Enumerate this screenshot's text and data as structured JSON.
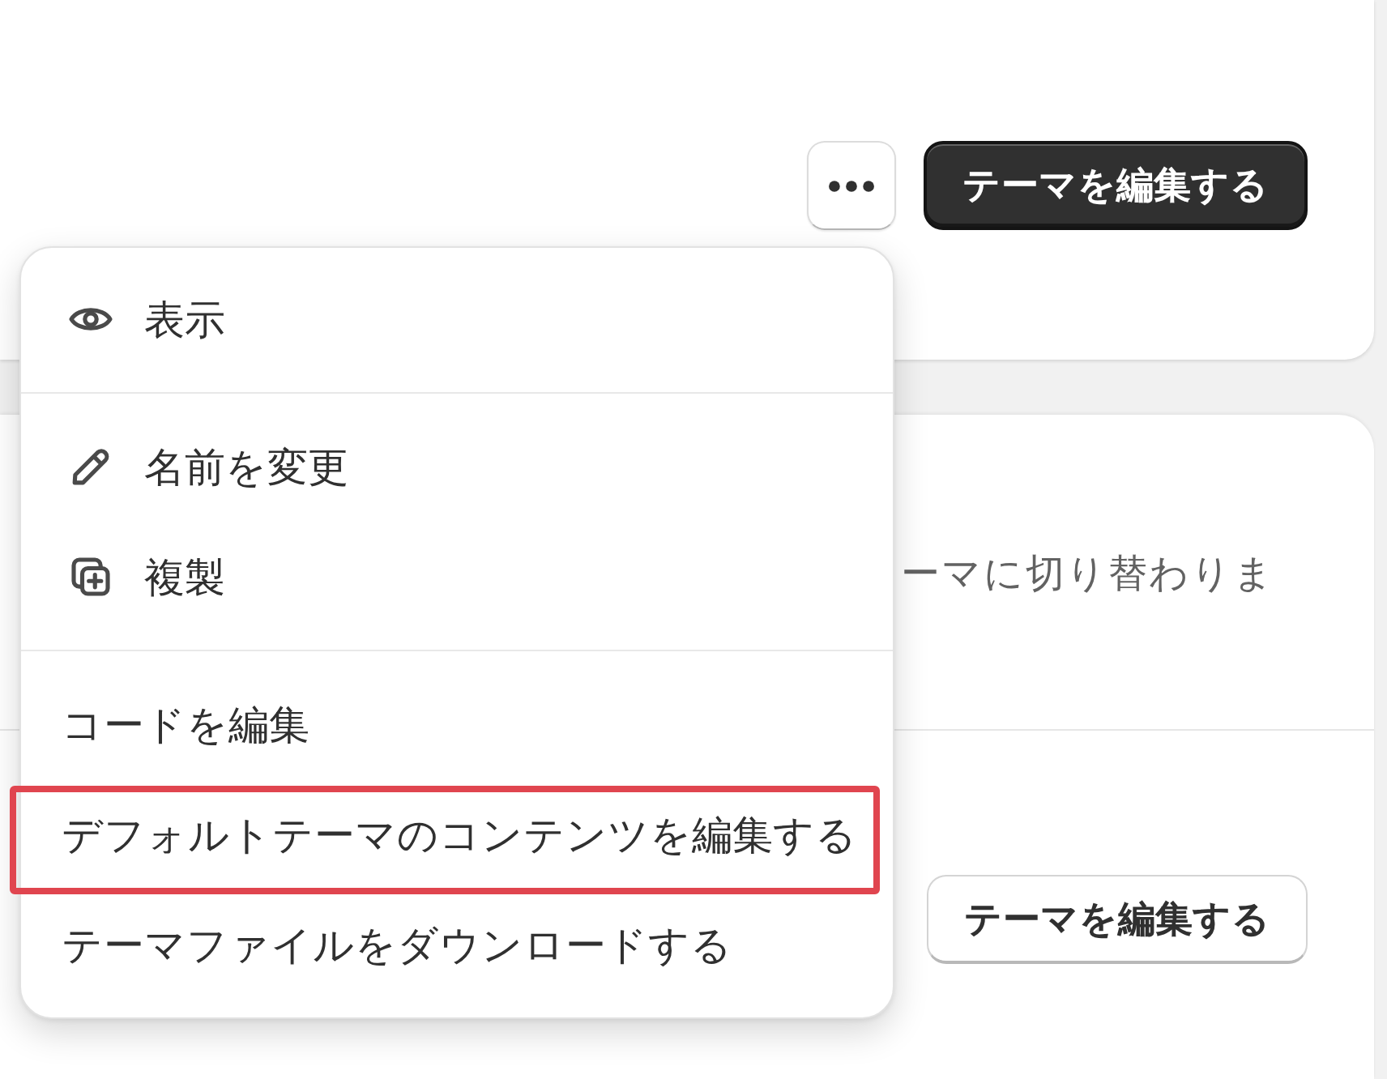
{
  "theme_card": {
    "primary_button": "テーマを編集する"
  },
  "second_card": {
    "description": "ーマに切り替わりま",
    "button": "テーマを編集する"
  },
  "actions_menu": {
    "sections": [
      {
        "items": [
          {
            "kind": "view",
            "label": "表示",
            "highlighted": false
          }
        ]
      },
      {
        "items": [
          {
            "kind": "rename",
            "label": "名前を変更",
            "highlighted": false
          },
          {
            "kind": "duplicate",
            "label": "複製",
            "highlighted": false
          }
        ]
      },
      {
        "items": [
          {
            "kind": "text",
            "label": "コードを編集",
            "highlighted": false
          },
          {
            "kind": "text",
            "label": "デフォルトテーマのコンテンツを編集する",
            "highlighted": true
          },
          {
            "kind": "text",
            "label": "テーマファイルをダウンロードする",
            "highlighted": false
          }
        ]
      }
    ]
  }
}
